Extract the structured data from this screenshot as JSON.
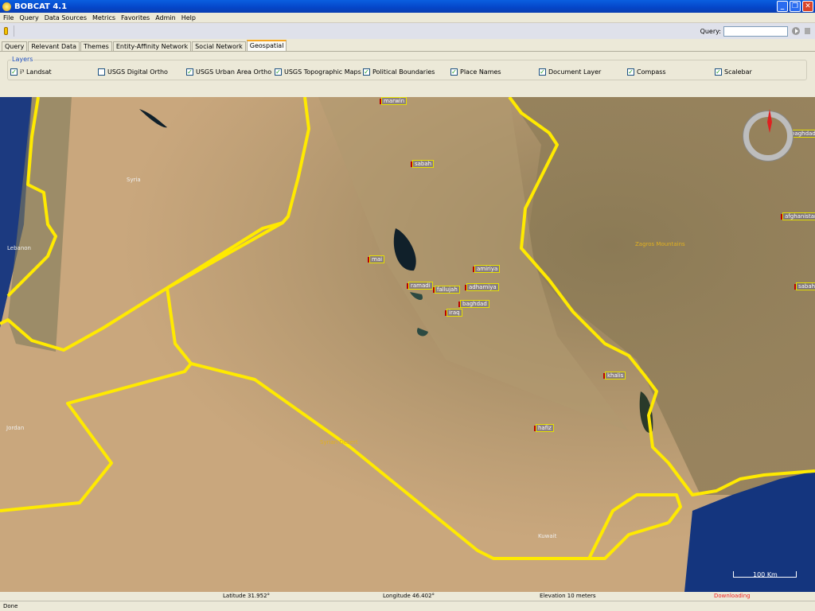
{
  "window": {
    "title": "BOBCAT 4.1"
  },
  "menu": [
    "File",
    "Query",
    "Data Sources",
    "Metrics",
    "Favorites",
    "Admin",
    "Help"
  ],
  "toolbar": {
    "query_label": "Query:",
    "query_value": ""
  },
  "tabs": [
    "Query",
    "Relevant Data",
    "Themes",
    "Entity-Affinity Network",
    "Social Network",
    "Geospatial"
  ],
  "active_tab": "Geospatial",
  "layers": {
    "title": "Layers",
    "items": [
      {
        "label": "i³ Landsat",
        "checked": true
      },
      {
        "label": "USGS Digital Ortho",
        "checked": false
      },
      {
        "label": "USGS Urban Area Ortho",
        "checked": true
      },
      {
        "label": "USGS Topographic Maps",
        "checked": true
      },
      {
        "label": "Political Boundaries",
        "checked": true
      },
      {
        "label": "Place Names",
        "checked": true
      },
      {
        "label": "Document Layer",
        "checked": true
      },
      {
        "label": "Compass",
        "checked": true
      },
      {
        "label": "Scalebar",
        "checked": true
      }
    ]
  },
  "map": {
    "places": [
      "marwin",
      "sabah",
      "mai",
      "ramadi",
      "fallujah",
      "amiriya",
      "adhamiya",
      "baghdad",
      "iraq",
      "khalis",
      "hafiz",
      "baghdad",
      "afghanistan",
      "sabah"
    ],
    "geo_labels": [
      "Syria",
      "Lebanon",
      "Jordan",
      "Syrian Desert",
      "Zagros Mountains",
      "Kuwait"
    ],
    "scalebar": "100 Km"
  },
  "status": {
    "latitude": "Latitude  31.952°",
    "longitude": "Longitude  46.402°",
    "elevation": "Elevation     10 meters",
    "downloading": "Downloading",
    "done": "Done"
  }
}
